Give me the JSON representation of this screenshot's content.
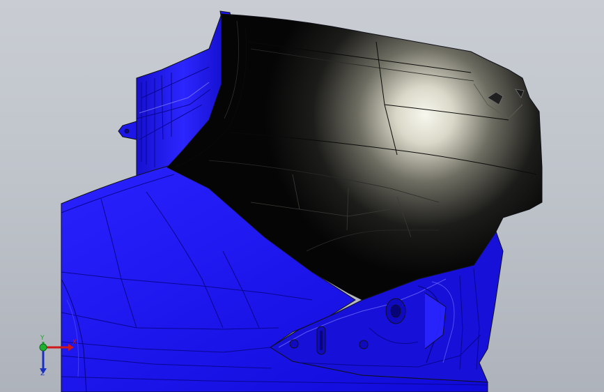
{
  "viewport": {
    "background_top": "#c9cdd3",
    "background_bottom": "#aeb3bb"
  },
  "model": {
    "blue_panel_color": "#1a14f0",
    "blue_panel_dark": "#0d08b8",
    "selected_panel_color": "#0b0b0b",
    "selected_highlight": "#f4f4ec",
    "edge_color": "#101018"
  },
  "triad": {
    "x_label": "X",
    "y_label": "Y",
    "z_label": "Z",
    "x_color": "#d01818",
    "y_color": "#20a030",
    "z_color": "#1a2fc0"
  }
}
